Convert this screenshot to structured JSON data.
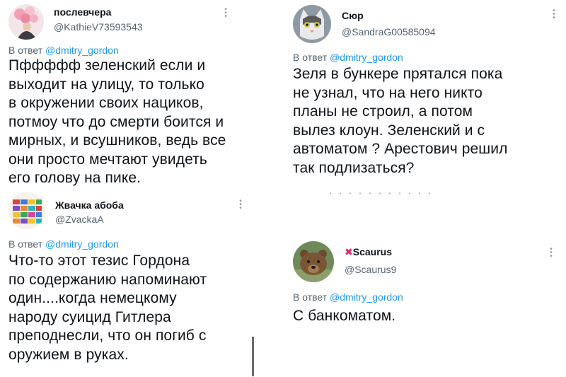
{
  "reply_prefix": "В ответ",
  "mention": "@dmitry_gordon",
  "posts": [
    {
      "display_name": "послевчера",
      "handle": "@KathieV73593543",
      "text": "Пффффф зеленский если и\nвыходит на улицу, то только\nв окружении своих нациков,\nпотмоу что до смерти боится и\nмирных, и всушников, ведь все\nони просто мечтают увидеть\nего голову на пике."
    },
    {
      "display_name": "Сюр",
      "handle": "@SandraG00585094",
      "text": "Зеля в бункере прятался пока\nне узнал, что на него никто\nпланы не строил, а потом\nвылез клоун. Зеленский и с\nавтоматом ? Арестович решил\nтак подлизаться?"
    },
    {
      "display_name": "Жвачка абоба",
      "handle": "@ZvackaA",
      "text": "Что-то этот тезис Гордона\nпо содержанию напоминают\nодин....когда  немецкому\nнароду суицид  Гитлера\nпреподнесли, что он  погиб  с\nоружием   в руках."
    },
    {
      "display_name": "Scaurus",
      "handle": "@Scaurus9",
      "text": "С банкоматом."
    }
  ],
  "colors": {
    "text": "#0f1419",
    "secondary": "#536471",
    "link": "#1d9bf0",
    "x_mark": "#e0245e"
  },
  "icons": {
    "more": "vertical-ellipsis",
    "name_prefix_post4": "red-cross-mark"
  }
}
